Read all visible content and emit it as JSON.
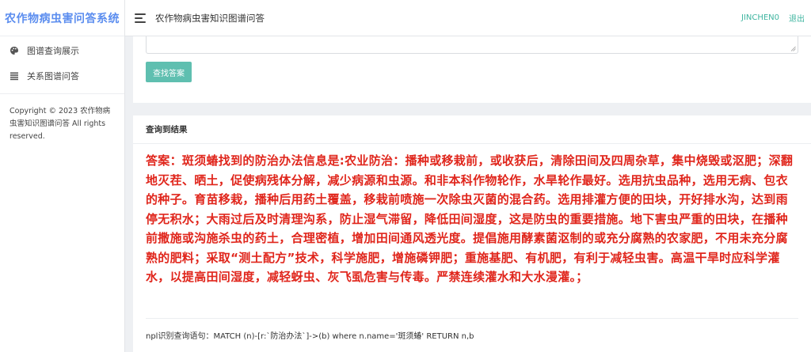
{
  "sidebar": {
    "brand": "农作物病虫害问答系统",
    "items": [
      {
        "label": "图谱查询展示",
        "icon": "palette-icon"
      },
      {
        "label": "关系图谱问答",
        "icon": "list-icon"
      }
    ],
    "copyright": "Copyright © 2023 农作物病虫害知识图谱问答 All rights reserved."
  },
  "header": {
    "title": "农作物病虫害知识图谱问答",
    "username": "JINCHEN0",
    "logout_label": "退出"
  },
  "query": {
    "search_button_label": "查找答案"
  },
  "result": {
    "section_title": "查询到结果",
    "answer_text": "答案：斑须蝽找到的防治办法信息是:农业防治：播种或移栽前，或收获后，清除田间及四周杂草，集中烧毁或沤肥；深翻地灭茬、晒土，促使病残体分解，减少病源和虫源。和非本科作物轮作，水旱轮作最好。选用抗虫品种，选用无病、包衣的种子。育苗移栽，播种后用药土覆盖，移栽前喷施一次除虫灭菌的混合药。选用排灌方便的田块，开好排水沟，达到雨停无积水；大雨过后及时清理沟系，防止湿气滞留，降低田间湿度，这是防虫的重要措施。地下害虫严重的田块，在播种前撒施或沟施杀虫的药土，合理密植，增加田间通风透光度。提倡施用酵素菌沤制的或充分腐熟的农家肥，不用未充分腐熟的肥料；采取“测土配方”技术，科学施肥，增施磷钾肥；重施基肥、有机肥，有利于减轻虫害。高温干旱时应科学灌水，以提高田间湿度，减轻蚜虫、灰飞虱危害与传毒。严禁连续灌水和大水漫灌。；",
    "cypher_text": "npl识别查询语句：MATCH (n)-[r:`防治办法`]->(b) where n.name='斑须蝽' RETURN n,b"
  },
  "colors": {
    "brand": "#5b8def",
    "accent": "#5fbfb0",
    "answer": "#e0261c"
  }
}
